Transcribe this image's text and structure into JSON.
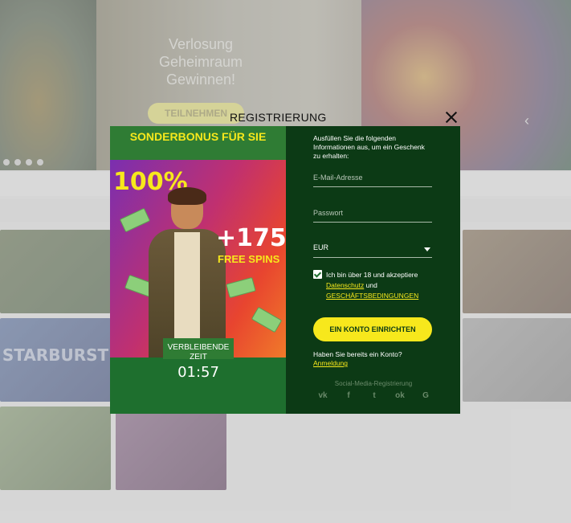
{
  "background": {
    "promo_title": "Verlosung Geheimraum Gewinnen!",
    "promo_button": "TEILNEHMEN",
    "tiles": [
      "",
      "",
      "",
      "",
      "",
      "STARBURST",
      "",
      "",
      "",
      "",
      "",
      ""
    ]
  },
  "modal": {
    "title": "REGISTRIERUNG",
    "promo": {
      "heading": "SONDERBONUS FÜR SIE",
      "percent": "100%",
      "spins_count": "+175",
      "spins_label": "FREE SPINS",
      "timer_label": "VERBLEIBENDE ZEIT",
      "timer_value": "01:57"
    },
    "form": {
      "intro": "Ausfüllen Sie die folgenden Informationen aus, um ein Geschenk zu erhalten:",
      "email_placeholder": "E-Mail-Adresse",
      "password_placeholder": "Passwort",
      "currency_value": "EUR",
      "consent_text": "Ich bin über 18 und akzeptiere",
      "privacy_link": "Datenschutz",
      "and_text": "und",
      "terms_link": "GESCHÄFTSBEDINGUNGEN",
      "submit_label": "EIN KONTO EINRICHTEN",
      "have_account": "Haben Sie bereits ein Konto?",
      "login_link": "Anmeldung",
      "social_label": "Social-Media-Registrierung",
      "social_icons": [
        "vk-icon",
        "facebook-icon",
        "twitter-icon",
        "odnoklassniki-icon",
        "google-icon"
      ],
      "social_glyphs": [
        "vk",
        "f",
        "t",
        "ok",
        "G"
      ]
    }
  },
  "colors": {
    "accent_yellow": "#f7e81c",
    "form_green": "#0c3a15",
    "promo_green": "#1e6f2e"
  }
}
